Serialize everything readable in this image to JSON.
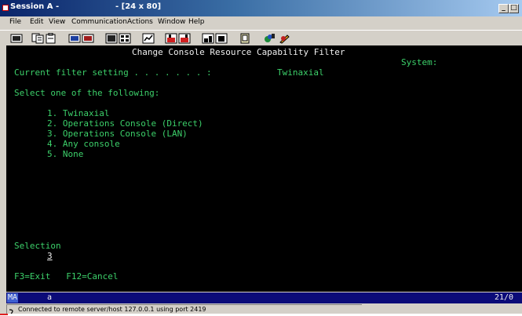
{
  "window": {
    "title_session": "Session A -",
    "title_size": "- [24 x 80]"
  },
  "menu": [
    {
      "label": "File"
    },
    {
      "label": "Edit"
    },
    {
      "label": "View"
    },
    {
      "label": "Communication"
    },
    {
      "label": "Actions"
    },
    {
      "label": "Window"
    },
    {
      "label": "Help"
    }
  ],
  "toolbar_icons": [
    "print-screen-icon",
    "copy-icon",
    "paste-icon",
    "send-icon",
    "receive-icon",
    "display-icon",
    "keypad-icon",
    "chart-icon",
    "record-macro-icon",
    "play-macro-icon",
    "run-icon",
    "stop-icon",
    "clipboard-icon",
    "color-icon",
    "edit-icon"
  ],
  "terminal": {
    "title": "Change Console Resource Capability Filter",
    "system_label": "System:",
    "current_label": "Current filter setting . . . . . . . :",
    "current_value": "Twinaxial",
    "prompt": "Select one of the following:",
    "options": [
      "1. Twinaxial",
      "2. Operations Console (Direct)",
      "3. Operations Console (LAN)",
      "4. Any console",
      "5. None"
    ],
    "selection_label": "Selection",
    "selection_value": "3",
    "fkeys": "F3=Exit   F12=Cancel"
  },
  "oia": {
    "mode": "MA",
    "indicator": "a",
    "cursor": "21/0"
  },
  "status": {
    "text": "Connected to remote server/host 127.0.0.1 using port 2419"
  }
}
